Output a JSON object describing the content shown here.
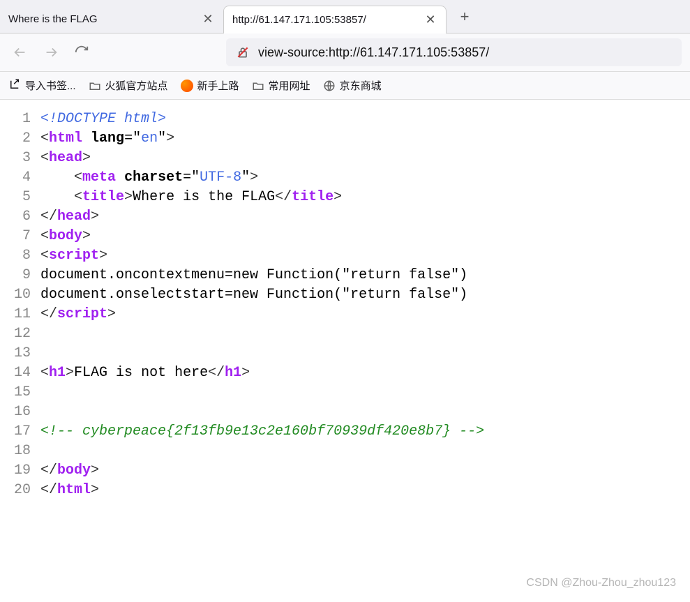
{
  "tabs": [
    {
      "title": "Where is the FLAG",
      "active": false
    },
    {
      "title": "http://61.147.171.105:53857/",
      "active": true
    }
  ],
  "icons": {
    "close": "✕",
    "plus": "+"
  },
  "url": "view-source:http://61.147.171.105:53857/",
  "bookmarks": [
    {
      "label": "导入书签...",
      "type": "import"
    },
    {
      "label": "火狐官方站点",
      "type": "folder"
    },
    {
      "label": "新手上路",
      "type": "firefox"
    },
    {
      "label": "常用网址",
      "type": "folder"
    },
    {
      "label": "京东商城",
      "type": "globe"
    }
  ],
  "source": {
    "lines": [
      {
        "n": "1",
        "parts": [
          {
            "t": "doctype",
            "v": "<!DOCTYPE html>"
          }
        ]
      },
      {
        "n": "2",
        "parts": [
          {
            "t": "angle",
            "v": "<"
          },
          {
            "t": "tag",
            "v": "html"
          },
          {
            "t": "text",
            "v": " "
          },
          {
            "t": "attr",
            "v": "lang"
          },
          {
            "t": "text",
            "v": "=\""
          },
          {
            "t": "val",
            "v": "en"
          },
          {
            "t": "text",
            "v": "\""
          },
          {
            "t": "angle",
            "v": ">"
          }
        ]
      },
      {
        "n": "3",
        "parts": [
          {
            "t": "angle",
            "v": "<"
          },
          {
            "t": "tag",
            "v": "head"
          },
          {
            "t": "angle",
            "v": ">"
          }
        ]
      },
      {
        "n": "4",
        "parts": [
          {
            "t": "text",
            "v": "    "
          },
          {
            "t": "angle",
            "v": "<"
          },
          {
            "t": "tag",
            "v": "meta"
          },
          {
            "t": "text",
            "v": " "
          },
          {
            "t": "attr",
            "v": "charset"
          },
          {
            "t": "text",
            "v": "=\""
          },
          {
            "t": "val",
            "v": "UTF-8"
          },
          {
            "t": "text",
            "v": "\""
          },
          {
            "t": "angle",
            "v": ">"
          }
        ]
      },
      {
        "n": "5",
        "parts": [
          {
            "t": "text",
            "v": "    "
          },
          {
            "t": "angle",
            "v": "<"
          },
          {
            "t": "tag",
            "v": "title"
          },
          {
            "t": "angle",
            "v": ">"
          },
          {
            "t": "text",
            "v": "Where is the FLAG"
          },
          {
            "t": "angle",
            "v": "</"
          },
          {
            "t": "tag",
            "v": "title"
          },
          {
            "t": "angle",
            "v": ">"
          }
        ]
      },
      {
        "n": "6",
        "parts": [
          {
            "t": "angle",
            "v": "</"
          },
          {
            "t": "tag",
            "v": "head"
          },
          {
            "t": "angle",
            "v": ">"
          }
        ]
      },
      {
        "n": "7",
        "parts": [
          {
            "t": "angle",
            "v": "<"
          },
          {
            "t": "tag",
            "v": "body"
          },
          {
            "t": "angle",
            "v": ">"
          }
        ]
      },
      {
        "n": "8",
        "parts": [
          {
            "t": "angle",
            "v": "<"
          },
          {
            "t": "tag",
            "v": "script"
          },
          {
            "t": "angle",
            "v": ">"
          }
        ]
      },
      {
        "n": "9",
        "parts": [
          {
            "t": "text",
            "v": "document.oncontextmenu=new Function(\"return false\")"
          }
        ]
      },
      {
        "n": "10",
        "parts": [
          {
            "t": "text",
            "v": "document.onselectstart=new Function(\"return false\")"
          }
        ]
      },
      {
        "n": "11",
        "parts": [
          {
            "t": "angle",
            "v": "</"
          },
          {
            "t": "tag",
            "v": "script"
          },
          {
            "t": "angle",
            "v": ">"
          }
        ]
      },
      {
        "n": "12",
        "parts": []
      },
      {
        "n": "13",
        "parts": []
      },
      {
        "n": "14",
        "parts": [
          {
            "t": "angle",
            "v": "<"
          },
          {
            "t": "tag",
            "v": "h1"
          },
          {
            "t": "angle",
            "v": ">"
          },
          {
            "t": "text",
            "v": "FLAG is not here"
          },
          {
            "t": "angle",
            "v": "</"
          },
          {
            "t": "tag",
            "v": "h1"
          },
          {
            "t": "angle",
            "v": ">"
          }
        ]
      },
      {
        "n": "15",
        "parts": []
      },
      {
        "n": "16",
        "parts": []
      },
      {
        "n": "17",
        "parts": [
          {
            "t": "comment",
            "v": "<!-- cyberpeace{2f13fb9e13c2e160bf70939df420e8b7} -->"
          }
        ]
      },
      {
        "n": "18",
        "parts": []
      },
      {
        "n": "19",
        "parts": [
          {
            "t": "angle",
            "v": "</"
          },
          {
            "t": "tag",
            "v": "body"
          },
          {
            "t": "angle",
            "v": ">"
          }
        ]
      },
      {
        "n": "20",
        "parts": [
          {
            "t": "angle",
            "v": "</"
          },
          {
            "t": "tag",
            "v": "html"
          },
          {
            "t": "angle",
            "v": ">"
          }
        ]
      }
    ]
  },
  "watermark": "CSDN @Zhou-Zhou_zhou123"
}
